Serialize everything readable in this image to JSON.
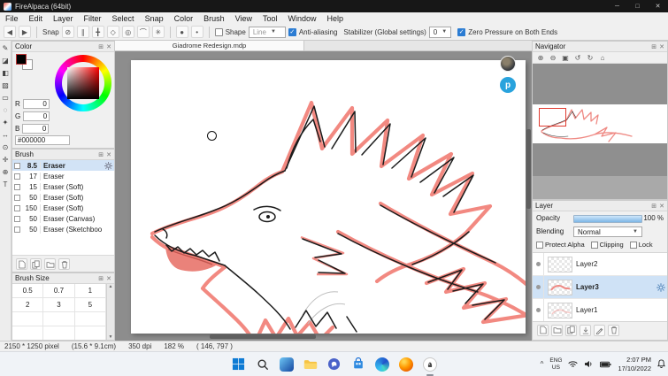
{
  "window": {
    "title": "FireAlpaca (64bit)",
    "minimize_glyph": "─",
    "maximize_glyph": "□",
    "close_glyph": "✕"
  },
  "panel": {
    "float_glyph": "⊞",
    "close_glyph": "✕"
  },
  "menu": {
    "items": [
      "File",
      "Edit",
      "Layer",
      "Filter",
      "Select",
      "Snap",
      "Color",
      "Brush",
      "View",
      "Tool",
      "Window",
      "Help"
    ]
  },
  "toolbar": {
    "back_glyph": "◀",
    "forward_glyph": "▶",
    "snap_label": "Snap",
    "snap_icons": [
      "⊘",
      "∥",
      "╋",
      "◇",
      "◎",
      "⌒",
      "✳"
    ],
    "tip_icons": [
      "●",
      "•"
    ],
    "shape_label": "Shape",
    "shape_value": "Line",
    "antialiasing_label": "Anti-aliasing",
    "stabilizer_label": "Stabilizer (Global settings)",
    "stabilizer_value": "0",
    "zero_pressure_label": "Zero Pressure on Both Ends",
    "check_glyph": "✓",
    "dropdown_glyph": "▼"
  },
  "tools": {
    "glyphs": [
      "✎",
      "◪",
      "◧",
      "▨",
      "▭",
      "◌",
      "✦",
      "↔",
      "⊙",
      "✛",
      "⊕",
      "T"
    ]
  },
  "color_panel": {
    "title": "Color",
    "channels": [
      {
        "label": "R",
        "value": "0"
      },
      {
        "label": "G",
        "value": "0"
      },
      {
        "label": "B",
        "value": "0"
      }
    ],
    "hex": "#000000"
  },
  "brush_panel": {
    "title": "Brush",
    "items": [
      {
        "size": "8.5",
        "name": "Eraser",
        "selected": true
      },
      {
        "size": "17",
        "name": "Eraser"
      },
      {
        "size": "15",
        "name": "Eraser (Soft)"
      },
      {
        "size": "50",
        "name": "Eraser (Soft)"
      },
      {
        "size": "150",
        "name": "Eraser (Soft)"
      },
      {
        "size": "50",
        "name": "Eraser (Canvas)"
      },
      {
        "size": "50",
        "name": "Eraser (Sketchboo"
      }
    ]
  },
  "brush_size_panel": {
    "title": "Brush Size",
    "values": [
      "0.5",
      "0.7",
      "1",
      "2",
      "3",
      "5"
    ],
    "scroll_up_glyph": "▲",
    "scroll_down_glyph": "▼"
  },
  "canvas": {
    "tab_title": "Giadrome Redesign.mdp",
    "cloud_badge": "p"
  },
  "navigator": {
    "title": "Navigator",
    "zoom_icons": [
      "⊕",
      "⊖",
      "▣",
      "↺",
      "↻",
      "⌂"
    ]
  },
  "layer_panel": {
    "title": "Layer",
    "opacity_label": "Opacity",
    "opacity_value": "100 %",
    "blending_label": "Blending",
    "blending_value": "Normal",
    "protect_alpha_label": "Protect Alpha",
    "clipping_label": "Clipping",
    "lock_label": "Lock",
    "layers": [
      {
        "name": "Layer2"
      },
      {
        "name": "Layer3",
        "selected": true
      },
      {
        "name": "Layer1"
      }
    ]
  },
  "status": {
    "pixels": "2150 * 1250 pixel",
    "size": "(15.6 * 9.1cm)",
    "dpi": "350 dpi",
    "zoom": "182 %",
    "cursor": "( 146, 797 )"
  },
  "taskbar": {
    "chevron": "^",
    "language": "ENG",
    "region": "US",
    "time": "2:07 PM",
    "date": "17/10/2022"
  }
}
